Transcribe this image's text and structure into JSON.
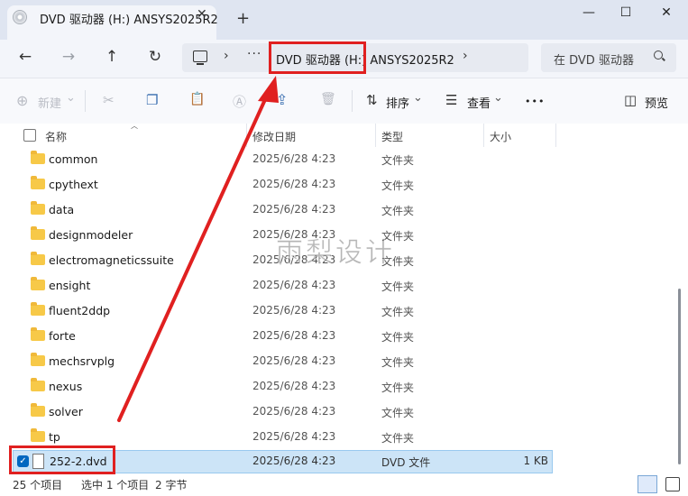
{
  "window": {
    "tab_title": "DVD 驱动器 (H:) ANSYS2025R2",
    "tab_close_glyph": "✕",
    "new_tab_glyph": "+",
    "minimize_glyph": "—",
    "maximize_glyph": "☐",
    "close_glyph": "✕"
  },
  "nav": {
    "back_glyph": "←",
    "forward_glyph": "→",
    "up_glyph": "↑",
    "refresh_glyph": "↻",
    "chevron_glyph": "›",
    "overflow_glyph": "···",
    "address_text": "DVD 驱动器 (H:) ANSYS2025R2",
    "search_placeholder": "在 DVD 驱动器"
  },
  "toolbar": {
    "new_label": "新建",
    "new_glyph": "⊕",
    "dropdown_glyph": "⌄",
    "cut_glyph": "✂",
    "copy_glyph": "❐",
    "paste_glyph": "📋",
    "rename_glyph": "Ⓐ",
    "share_glyph": "⇪",
    "delete_glyph": "🗑",
    "sort_label": "排序",
    "sort_glyph": "⇅",
    "view_label": "查看",
    "view_glyph": "☰",
    "more_glyph": "•••",
    "preview_label": "预览",
    "preview_glyph": "◫"
  },
  "columns": {
    "name": "名称",
    "modified": "修改日期",
    "type": "类型",
    "size": "大小",
    "sort_glyph": "︿"
  },
  "folders": [
    {
      "name": "common",
      "modified": "2025/6/28 4:23",
      "type": "文件夹",
      "size": ""
    },
    {
      "name": "cpythext",
      "modified": "2025/6/28 4:23",
      "type": "文件夹",
      "size": ""
    },
    {
      "name": "data",
      "modified": "2025/6/28 4:23",
      "type": "文件夹",
      "size": ""
    },
    {
      "name": "designmodeler",
      "modified": "2025/6/28 4:23",
      "type": "文件夹",
      "size": ""
    },
    {
      "name": "electromagneticssuite",
      "modified": "2025/6/28 4:23",
      "type": "文件夹",
      "size": ""
    },
    {
      "name": "ensight",
      "modified": "2025/6/28 4:23",
      "type": "文件夹",
      "size": ""
    },
    {
      "name": "fluent2ddp",
      "modified": "2025/6/28 4:23",
      "type": "文件夹",
      "size": ""
    },
    {
      "name": "forte",
      "modified": "2025/6/28 4:23",
      "type": "文件夹",
      "size": ""
    },
    {
      "name": "mechsrvplg",
      "modified": "2025/6/28 4:23",
      "type": "文件夹",
      "size": ""
    },
    {
      "name": "nexus",
      "modified": "2025/6/28 4:23",
      "type": "文件夹",
      "size": ""
    },
    {
      "name": "solver",
      "modified": "2025/6/28 4:23",
      "type": "文件夹",
      "size": ""
    },
    {
      "name": "tp",
      "modified": "2025/6/28 4:23",
      "type": "文件夹",
      "size": ""
    }
  ],
  "selected_file": {
    "name": "252-2.dvd",
    "modified": "2025/6/28 4:23",
    "type": "DVD 文件",
    "size": "1 KB",
    "check_glyph": "✓"
  },
  "status": {
    "item_count": "25 个项目",
    "selected": "选中 1 个项目",
    "selected_size": "2 字节"
  },
  "watermark": "雨梨设计",
  "colors": {
    "accent": "#0067c0",
    "highlight_red": "#e02020",
    "folder_yellow": "#f7c948",
    "selection_bg": "#cce4f7"
  }
}
